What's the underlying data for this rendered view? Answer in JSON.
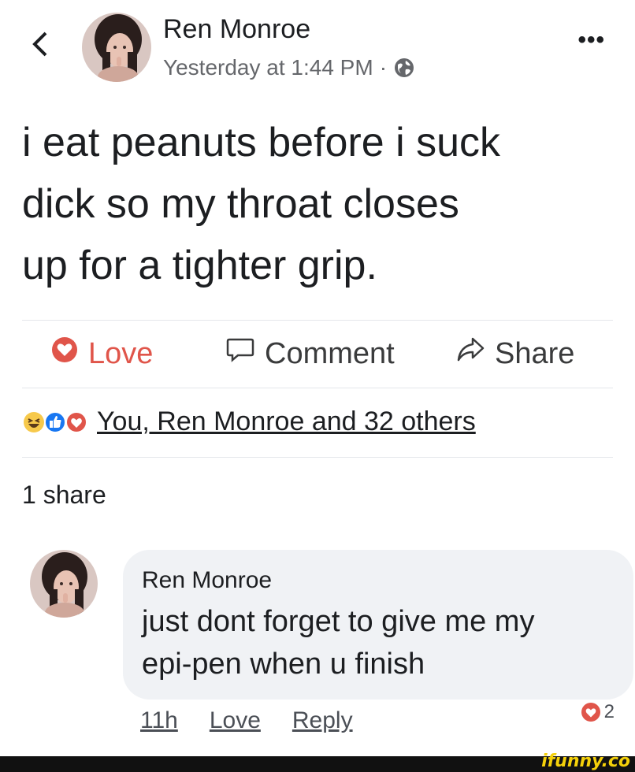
{
  "post": {
    "back_icon": "chevron-left-icon",
    "author": "Ren Monroe",
    "timestamp": "Yesterday at 1:44 PM",
    "separator": "·",
    "privacy_icon": "globe-icon",
    "more_label": "•••",
    "text_lines": [
      "i eat peanuts before i suck",
      "dick so my throat closes",
      "up for a tighter grip."
    ]
  },
  "actions": {
    "love_label": "Love",
    "comment_label": "Comment",
    "share_label": "Share"
  },
  "reactions": {
    "icons": [
      "haha-icon",
      "like-icon",
      "love-icon"
    ],
    "summary": "You, Ren Monroe and 32 others"
  },
  "shares": {
    "label": "1 share"
  },
  "comment": {
    "author": "Ren Monroe",
    "text_lines": [
      "just dont forget to give me my",
      "epi-pen when u finish"
    ],
    "time": "11h",
    "love_label": "Love",
    "reply_label": "Reply",
    "reaction_count": "2"
  },
  "watermark": {
    "text": "ifunny.co"
  },
  "colors": {
    "love_red": "#e0554a",
    "text": "#1c1e21",
    "muted": "#65676b",
    "bubble": "#f0f2f5",
    "like_blue": "#1877f2",
    "haha_yellow": "#f7c94b"
  }
}
